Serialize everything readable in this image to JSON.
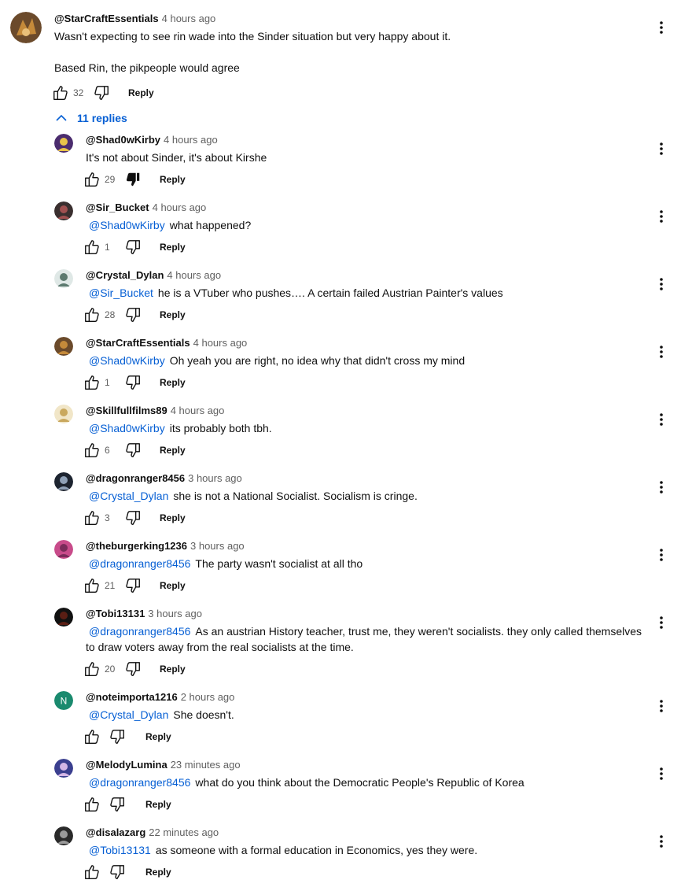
{
  "top_comment": {
    "author": "@StarCraftEssentials",
    "time": "4 hours ago",
    "lines": [
      "Wasn't expecting to see rin wade into the Sinder situation but very happy about it.",
      "Based Rin, the pikpeople would agree"
    ],
    "likes": "32",
    "reply_label": "Reply",
    "avatar_colors": [
      "#6b4a2b",
      "#c58a3a"
    ]
  },
  "replies_toggle": {
    "label": "11 replies",
    "icon": "chevron-up-icon"
  },
  "replies": [
    {
      "author": "@Shad0wKirby",
      "time": "4 hours ago",
      "mention": "",
      "text": "It's not about Sinder, it's about Kirshe",
      "text2": "",
      "likes": "29",
      "disliked": true,
      "reply_label": "Reply",
      "avatar_colors": [
        "#4b2c6e",
        "#e8c34a"
      ]
    },
    {
      "author": "@Sir_Bucket",
      "time": "4 hours ago",
      "mention": "@Shad0wKirby",
      "text": "what happened?",
      "text2": "",
      "likes": "1",
      "disliked": false,
      "reply_label": "Reply",
      "avatar_colors": [
        "#3a2f2f",
        "#a05050"
      ]
    },
    {
      "author": "@Crystal_Dylan",
      "time": "4 hours ago",
      "mention": "@Sir_Bucket",
      "text": "he is a VTuber who pushes…. A certain failed Austrian Painter's values",
      "text2": "",
      "likes": "28",
      "disliked": false,
      "reply_label": "Reply",
      "avatar_colors": [
        "#dfe8e6",
        "#5c7a6f"
      ]
    },
    {
      "author": "@StarCraftEssentials",
      "time": "4 hours ago",
      "mention": "@Shad0wKirby",
      "text": "Oh yeah you are right, no idea why that didn't cross my mind",
      "text2": "",
      "likes": "1",
      "disliked": false,
      "reply_label": "Reply",
      "avatar_colors": [
        "#6b4a2b",
        "#c58a3a"
      ]
    },
    {
      "author": "@Skillfullfilms89",
      "time": "4 hours ago",
      "mention": "@Shad0wKirby",
      "text": "its probably both tbh.",
      "text2": "",
      "likes": "6",
      "disliked": false,
      "reply_label": "Reply",
      "avatar_colors": [
        "#f1e6c8",
        "#c9a85e"
      ]
    },
    {
      "author": "@dragonranger8456",
      "time": "3 hours ago",
      "mention": "@Crystal_Dylan",
      "text": "she is not a National Socialist. Socialism is cringe.",
      "text2": "",
      "likes": "3",
      "disliked": false,
      "reply_label": "Reply",
      "avatar_colors": [
        "#1d2430",
        "#8fa1b8"
      ]
    },
    {
      "author": "@theburgerking1236",
      "time": "3 hours ago",
      "mention": "@dragonranger8456",
      "text": "The party wasn't socialist at all tho",
      "text2": "",
      "likes": "21",
      "disliked": false,
      "reply_label": "Reply",
      "avatar_colors": [
        "#c84b8a",
        "#7a2b5a"
      ]
    },
    {
      "author": "@Tobi13131",
      "time": "3 hours ago",
      "mention": "@dragonranger8456",
      "text": "As an austrian History teacher, trust me, they weren't socialists. they only called themselves",
      "text2": "to draw voters away from the real socialists at the time.",
      "likes": "20",
      "disliked": false,
      "reply_label": "Reply",
      "avatar_colors": [
        "#111111",
        "#5a1e14"
      ]
    },
    {
      "author": "@noteimporta1216",
      "time": "2 hours ago",
      "mention": "@Crystal_Dylan",
      "text": "She doesn't.",
      "text2": "",
      "likes": "",
      "disliked": false,
      "reply_label": "Reply",
      "avatar_colors": [
        "#1a8a6e",
        "#1a8a6e"
      ],
      "avatar_letter": "N"
    },
    {
      "author": "@MelodyLumina",
      "time": "23 minutes ago",
      "mention": "@dragonranger8456",
      "text": "what do you think about the Democratic People's Republic of Korea",
      "text2": "",
      "likes": "",
      "disliked": false,
      "reply_label": "Reply",
      "avatar_colors": [
        "#3b3f8f",
        "#d4b6e6"
      ]
    },
    {
      "author": "@disalazarg",
      "time": "22 minutes ago",
      "mention": "@Tobi13131",
      "text": "as someone with a formal education in Economics, yes they were.",
      "text2": "",
      "likes": "",
      "disliked": false,
      "reply_label": "Reply",
      "avatar_colors": [
        "#2a2a2a",
        "#9a9a9a"
      ]
    }
  ],
  "icons": {
    "like": "thumbs-up-icon",
    "dislike": "thumbs-down-icon",
    "menu": "more-vertical-icon"
  },
  "colors": {
    "link": "#065fd4",
    "secondary": "#606060",
    "text": "#0f0f0f"
  }
}
